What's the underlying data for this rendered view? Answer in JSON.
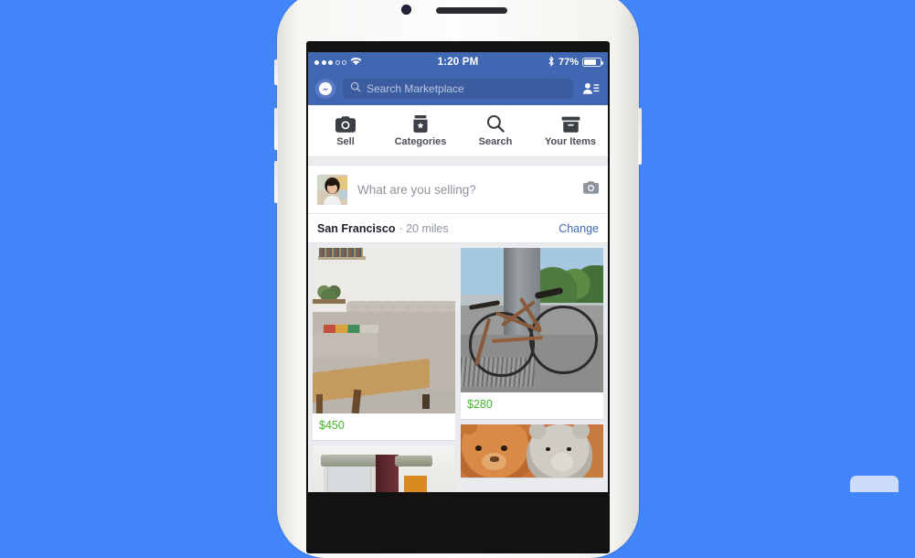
{
  "background": {
    "color": "#4285f8"
  },
  "device": {
    "name": "white-iphone",
    "frame_color": "#f7f6f3"
  },
  "statusbar": {
    "signal_dots_filled": 3,
    "signal_dots_empty": 2,
    "wifi_icon": "wifi-icon",
    "time": "1:20 PM",
    "bluetooth_icon": "bluetooth-icon",
    "battery_percent": "77%",
    "battery_level": 77,
    "bg_color": "#4267b2"
  },
  "navbar": {
    "messenger_icon": "messenger-icon",
    "search": {
      "icon": "search-icon",
      "placeholder": "Search Marketplace",
      "value": ""
    },
    "friend_requests_icon": "friend-requests-icon",
    "bg_color": "#4267b2"
  },
  "tabs": [
    {
      "label": "Sell",
      "icon": "camera-icon"
    },
    {
      "label": "Categories",
      "icon": "categories-jar-icon"
    },
    {
      "label": "Search",
      "icon": "search-icon"
    },
    {
      "label": "Your Items",
      "icon": "box-icon"
    }
  ],
  "composer": {
    "avatar": "user-avatar",
    "placeholder": "What are you selling?",
    "camera_icon": "camera-icon"
  },
  "location": {
    "city": "San Francisco",
    "distance": "· 20 miles",
    "change_label": "Change",
    "link_color": "#4267b2"
  },
  "feed": {
    "price_color": "#42b72a",
    "left_column": [
      {
        "image": "gray-tufted-sofa-with-wooden-coffee-table",
        "price": "$450"
      },
      {
        "image": "coffee-maker-appliance",
        "price": ""
      }
    ],
    "right_column": [
      {
        "image": "brown-road-bicycle-by-concrete-pillar",
        "price": "$280"
      },
      {
        "image": "plush-teddy-bears",
        "price": ""
      }
    ]
  }
}
